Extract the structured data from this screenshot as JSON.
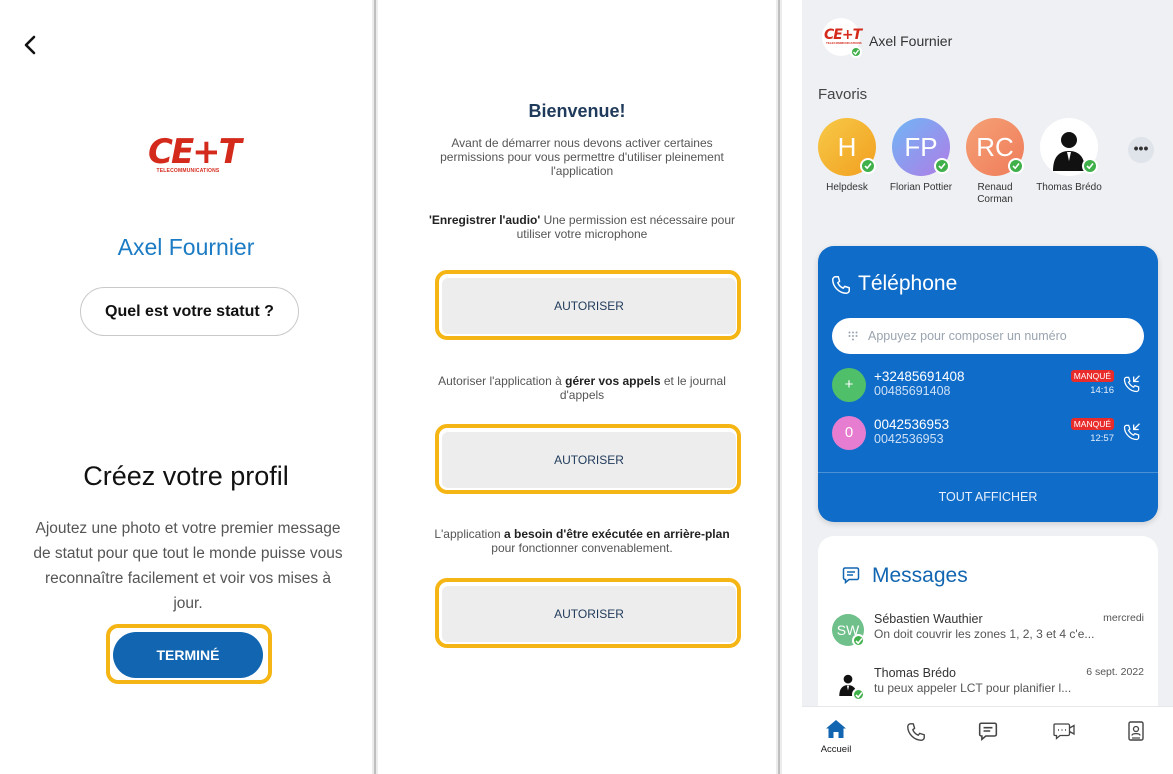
{
  "screen1": {
    "logo_text": "CE+T",
    "logo_sub": "TELECOMMUNICATIONS",
    "user_name": "Axel Fournier",
    "status_button": "Quel est votre statut ?",
    "heading": "Créez votre profil",
    "description": "Ajoutez une photo et votre premier message de statut pour que tout le monde puisse vous reconnaître facilement et voir vos mises à jour.",
    "done_button": "TERMINÉ"
  },
  "screen2": {
    "title": "Bienvenue!",
    "intro": "Avant de démarrer nous devons activer certaines permissions pour vous permettre d'utiliser pleinement l'application",
    "audio_bold": "'Enregistrer l'audio'",
    "audio_rest": " Une permission est nécessaire pour utiliser votre microphone",
    "calls_pre": "Autoriser l'application à ",
    "calls_bold": "gérer vos appels",
    "calls_post": " et le journal d'appels",
    "bg_pre": "L'application ",
    "bg_bold": "a besoin d'être exécutée en arrière-plan",
    "bg_post": " pour fonctionner convenablement.",
    "authorize_label": "AUTORISER"
  },
  "screen3": {
    "user_name": "Axel Fournier",
    "favorites_title": "Favoris",
    "favorites": [
      {
        "initials": "H",
        "name": "Helpdesk",
        "color_from": "#f7c948",
        "color_to": "#f29f1f"
      },
      {
        "initials": "FP",
        "name": "Florian Pottier",
        "color_from": "#6fb6f5",
        "color_to": "#b07ce6"
      },
      {
        "initials": "RC",
        "name": "Renaud Corman",
        "color_from": "#f5a176",
        "color_to": "#ef7c5a"
      },
      {
        "initials": "",
        "name": "Thomas Brédo",
        "color_from": "#ffffff",
        "color_to": "#ffffff"
      }
    ],
    "more_label": "•••",
    "phone": {
      "title": "Téléphone",
      "dial_placeholder": "Appuyez pour composer un numéro",
      "calls": [
        {
          "avatar": "+",
          "number": "+32485691408",
          "sub": "00485691408",
          "badge": "MANQUÉ",
          "time": "14:16",
          "avatar_color": "#4fbf6a"
        },
        {
          "avatar": "0",
          "number": "0042536953",
          "sub": "0042536953",
          "badge": "MANQUÉ",
          "time": "12:57",
          "avatar_color": "#e67dd0"
        }
      ],
      "show_all": "TOUT AFFICHER"
    },
    "messages": {
      "title": "Messages",
      "items": [
        {
          "avatar": "SW",
          "name": "Sébastien Wauthier",
          "text": "On doit couvrir les zones 1, 2, 3 et 4 c'e...",
          "date": "mercredi"
        },
        {
          "avatar": "",
          "name": "Thomas Brédo",
          "text": "tu peux appeler LCT pour planifier l...",
          "date": "6 sept. 2022"
        }
      ]
    },
    "nav": {
      "home_label": "Accueil"
    }
  },
  "colors": {
    "highlight": "#f5b514",
    "brand_blue": "#1266b1",
    "card_blue": "#0f6cc9",
    "missed_red": "#e82c2c",
    "online_green": "#3fb04a"
  }
}
